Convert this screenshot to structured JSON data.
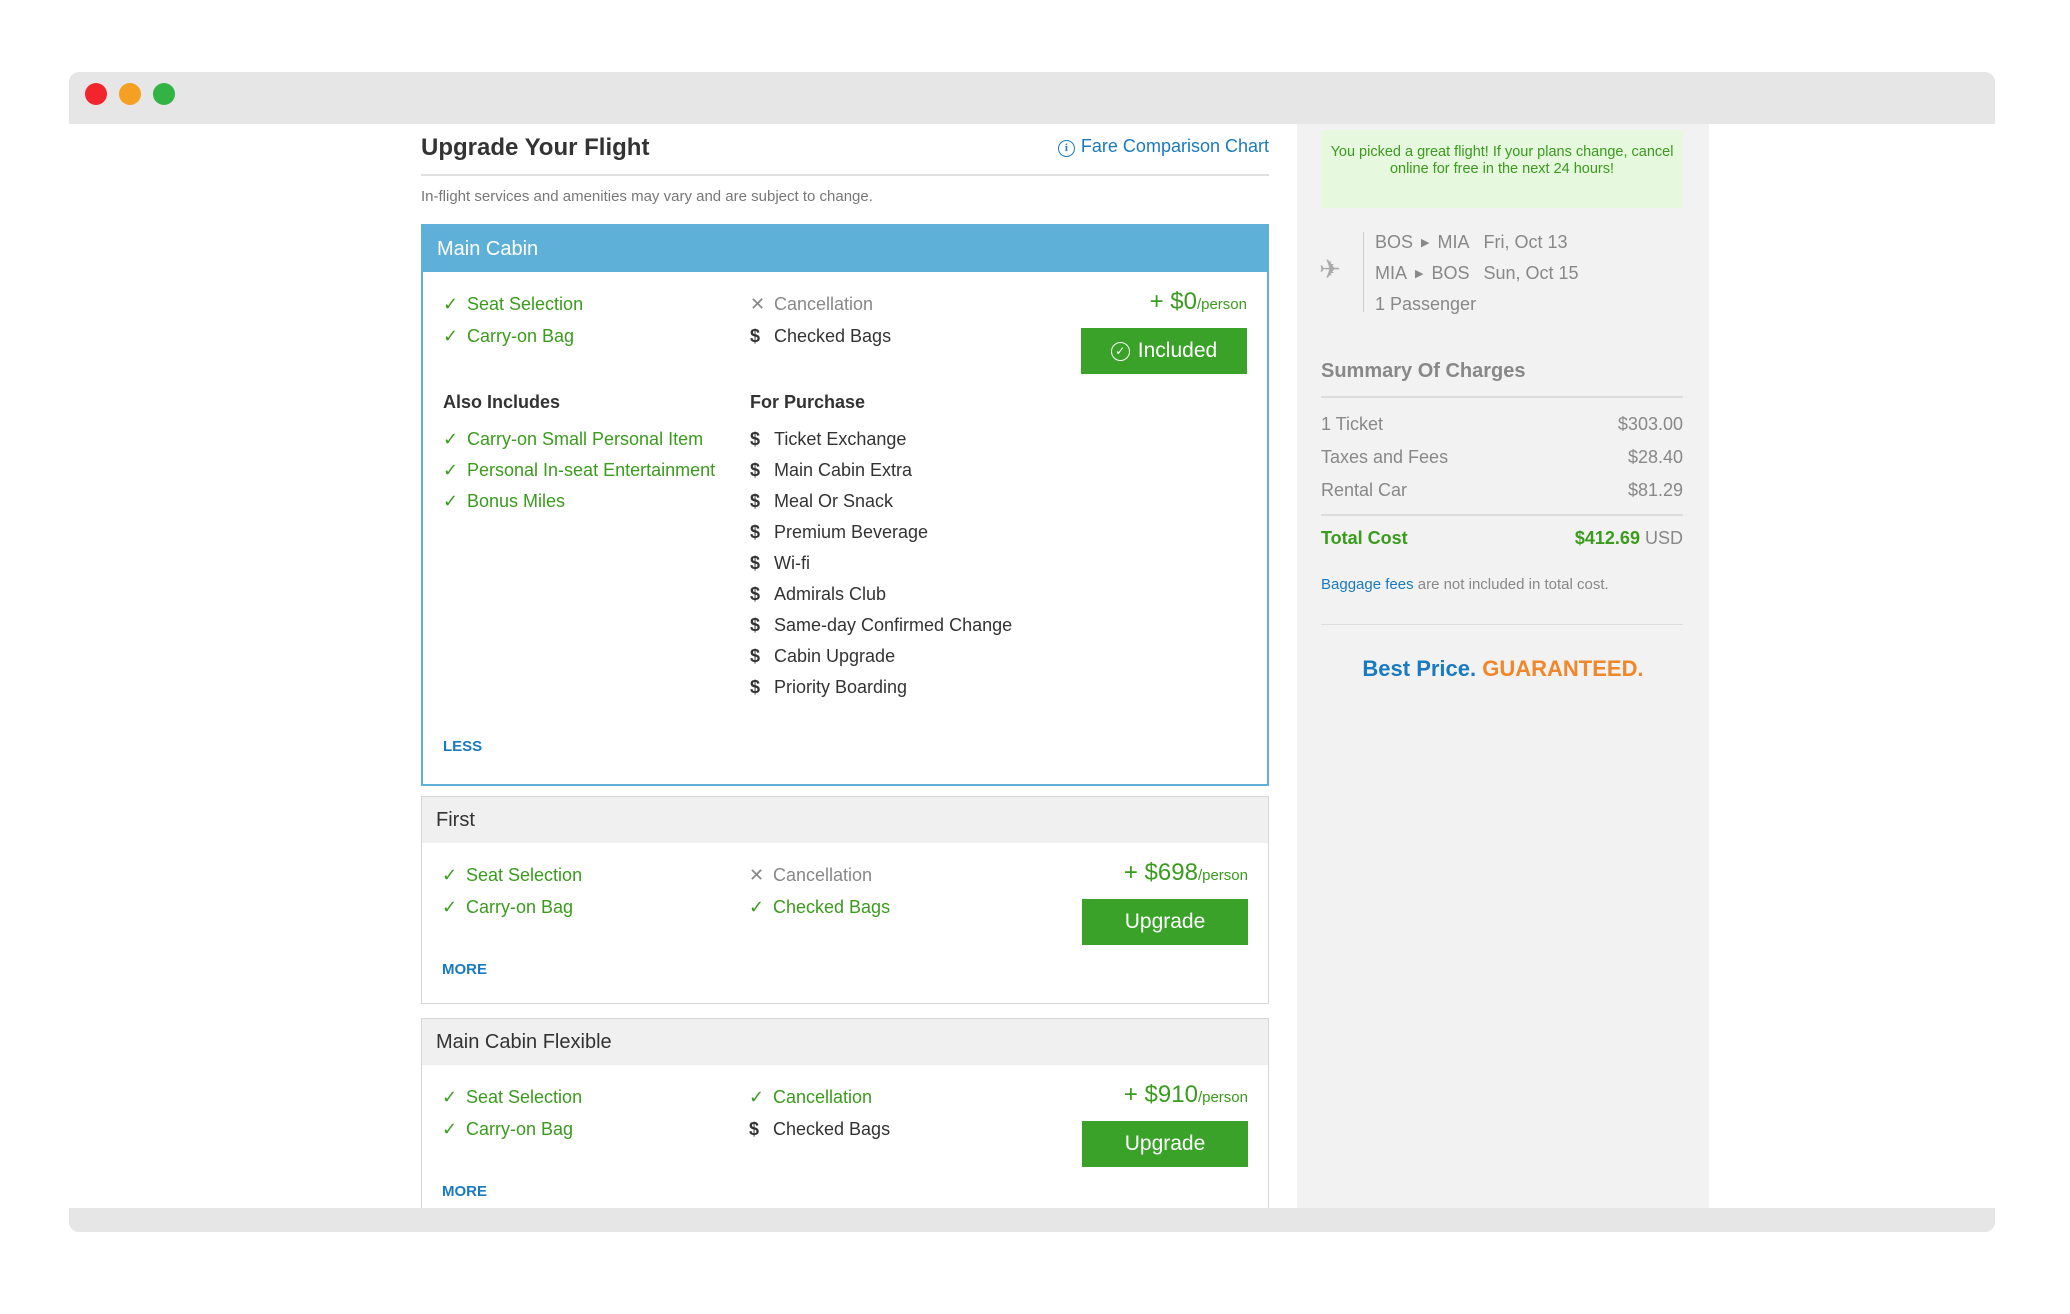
{
  "header": {
    "title": "Upgrade Your Flight",
    "fare_link": "Fare Comparison Chart",
    "disclaimer": "In-flight services and amenities may vary and are subject to change."
  },
  "fares": [
    {
      "name": "Main Cabin",
      "selected": true,
      "col1": [
        {
          "label": "Seat Selection",
          "status": "included"
        },
        {
          "label": "Carry-on Bag",
          "status": "included"
        }
      ],
      "col2": [
        {
          "label": "Cancellation",
          "status": "not-available"
        },
        {
          "label": "Checked Bags",
          "status": "purchase"
        }
      ],
      "price": "+ $0",
      "per": "/person",
      "button": "Included",
      "also_includes_title": "Also Includes",
      "also_includes": [
        "Carry-on Small Personal Item",
        "Personal In-seat Entertainment",
        "Bonus Miles"
      ],
      "for_purchase_title": "For Purchase",
      "for_purchase": [
        "Ticket Exchange",
        "Main Cabin Extra",
        "Meal Or Snack",
        "Premium Beverage",
        "Wi-fi",
        "Admirals Club",
        "Same-day Confirmed Change",
        "Cabin Upgrade",
        "Priority Boarding"
      ],
      "toggle": "LESS"
    },
    {
      "name": "First",
      "selected": false,
      "col1": [
        {
          "label": "Seat Selection",
          "status": "included"
        },
        {
          "label": "Carry-on Bag",
          "status": "included"
        }
      ],
      "col2": [
        {
          "label": "Cancellation",
          "status": "not-available"
        },
        {
          "label": "Checked Bags",
          "status": "included"
        }
      ],
      "price": "+ $698",
      "per": "/person",
      "button": "Upgrade",
      "toggle": "MORE"
    },
    {
      "name": "Main Cabin Flexible",
      "selected": false,
      "col1": [
        {
          "label": "Seat Selection",
          "status": "included"
        },
        {
          "label": "Carry-on Bag",
          "status": "included"
        }
      ],
      "col2": [
        {
          "label": "Cancellation",
          "status": "included"
        },
        {
          "label": "Checked Bags",
          "status": "purchase"
        }
      ],
      "price": "+ $910",
      "per": "/person",
      "button": "Upgrade",
      "toggle": "MORE"
    }
  ],
  "sidebar": {
    "notice": "You picked a great flight! If your plans change, cancel online for free in the next 24 hours!",
    "trip": [
      {
        "from": "BOS",
        "to": "MIA",
        "date": "Fri, Oct 13"
      },
      {
        "from": "MIA",
        "to": "BOS",
        "date": "Sun, Oct 15"
      }
    ],
    "passengers": "1 Passenger",
    "summary_title": "Summary Of Charges",
    "charges": [
      {
        "label": "1 Ticket",
        "value": "$303.00"
      },
      {
        "label": "Taxes and Fees",
        "value": "$28.40"
      },
      {
        "label": "Rental Car",
        "value": "$81.29"
      }
    ],
    "total_label": "Total Cost",
    "total_value": "$412.69",
    "currency": "USD",
    "baggage_link": "Baggage fees",
    "baggage_text": " are not included in total cost.",
    "best_price": "Best Price.",
    "guaranteed": "GUARANTEED."
  },
  "colors": {
    "accent_blue": "#1a7abf",
    "selected_header": "#5fb0d9",
    "green": "#3a9b1d",
    "button_green": "#3aa228",
    "orange": "#f0872a"
  }
}
